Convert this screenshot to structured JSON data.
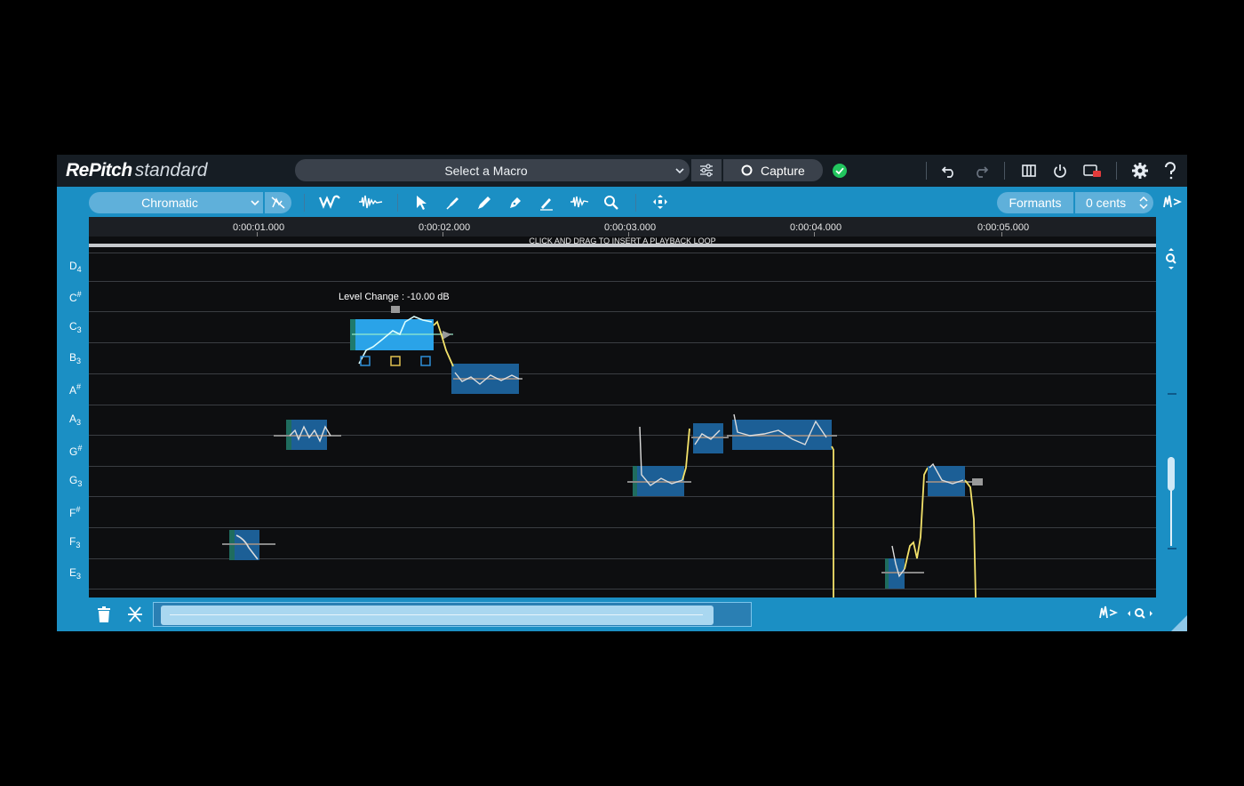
{
  "app": {
    "brand": "RePitch",
    "edition": "standard"
  },
  "titlebar": {
    "macro_placeholder": "Select a Macro",
    "capture_label": "Capture",
    "status_color": "#22c55e"
  },
  "toolbar": {
    "scale_mode": "Chromatic",
    "formants_label": "Formants",
    "cents_value": "0 cents"
  },
  "ruler": {
    "times": [
      "0:00:01.000",
      "0:00:02.000",
      "0:00:03.000",
      "0:00:04.000",
      "0:00:05.000"
    ],
    "loop_hint": "CLICK AND DRAG TO INSERT A PLAYBACK LOOP"
  },
  "notes": [
    {
      "name": "D",
      "mod": "4",
      "type": "sub"
    },
    {
      "name": "C",
      "mod": "#",
      "type": "sup"
    },
    {
      "name": "C",
      "mod": "3",
      "type": "sub"
    },
    {
      "name": "B",
      "mod": "3",
      "type": "sub"
    },
    {
      "name": "A",
      "mod": "#",
      "type": "sup"
    },
    {
      "name": "A",
      "mod": "3",
      "type": "sub"
    },
    {
      "name": "G",
      "mod": "#",
      "type": "sup"
    },
    {
      "name": "G",
      "mod": "3",
      "type": "sub"
    },
    {
      "name": "F",
      "mod": "#",
      "type": "sup"
    },
    {
      "name": "F",
      "mod": "3",
      "type": "sub"
    },
    {
      "name": "E",
      "mod": "3",
      "type": "sub"
    }
  ],
  "tooltip": {
    "text": "Level Change : -10.00 dB"
  }
}
